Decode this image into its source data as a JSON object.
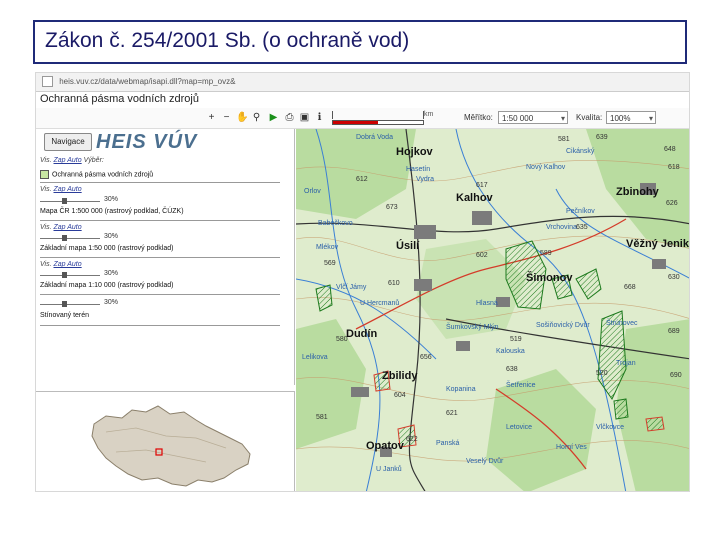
{
  "slide": {
    "title": "Zákon č. 254/2001 Sb. (o ochraně vod)"
  },
  "browser": {
    "url": "heis.vuv.cz/data/webmap/isapi.dll?map=mp_ovz&"
  },
  "app": {
    "title": "Ochranná pásma vodních zdrojů",
    "toolbar": {
      "scale_unit": "km",
      "meritko_label": "Měřítko:",
      "meritko_value": "1:50 000",
      "kvalita_label": "Kvalita:",
      "kvalita_value": "100%"
    },
    "sidebar": {
      "nav_button": "Navigace",
      "logo_text": "HEIS VÚV",
      "rows": [
        {
          "vis": "Vis.",
          "mode": "Zap Auto",
          "extra": "Výběr:"
        },
        {
          "vis": "Vis.",
          "mode": "Zap Auto",
          "extra": ""
        },
        {
          "vis": "Vis.",
          "mode": "Zap Auto",
          "extra": ""
        },
        {
          "vis": "Vis.",
          "mode": "Zap Auto",
          "extra": ""
        }
      ],
      "layers": [
        "Ochranná pásma vodních zdrojů",
        "Mapa ČR 1:500 000 (rastrový podklad, ČÚZK)",
        "Základní mapa 1:50 000 (rastrový podklad)",
        "Základní mapa 1:10 000 (rastrový podklad)",
        "Stínovaný terén"
      ],
      "percents": [
        "30%",
        "30%",
        "30%",
        "30%"
      ]
    },
    "map": {
      "places": [
        "Hojkov",
        "Vydra",
        "Kalhov",
        "Zbinohy",
        "Úsilí",
        "Věžný Jenikov",
        "Šimonov",
        "Dudín",
        "Zbilidy",
        "Opatov",
        "U Janků",
        "Hasetín",
        "Orlov",
        "Babečkovo",
        "Nový Kalhov",
        "Cikánský",
        "Vlčí Jámy",
        "U Hercmanů",
        "Šumkovský Mlýn",
        "Sošiňovický Dvůr",
        "Štrúnovec",
        "Trojan",
        "Kalouska",
        "Šetřenice",
        "Vrchovina",
        "Dobrá Voda",
        "Veselý Dvůr",
        "Panská",
        "Mlékov",
        "Pečníkov",
        "Hlasná",
        "Lelikova",
        "Kopanina",
        "Vlčkovce",
        "Horní Ves",
        "Letovice"
      ],
      "spot_heights": [
        "581",
        "639",
        "648",
        "618",
        "626",
        "635",
        "617",
        "612",
        "673",
        "602",
        "569",
        "589",
        "630",
        "610",
        "668",
        "580",
        "689",
        "656",
        "690",
        "638",
        "604",
        "621",
        "622",
        "519",
        "520",
        "581"
      ]
    }
  }
}
